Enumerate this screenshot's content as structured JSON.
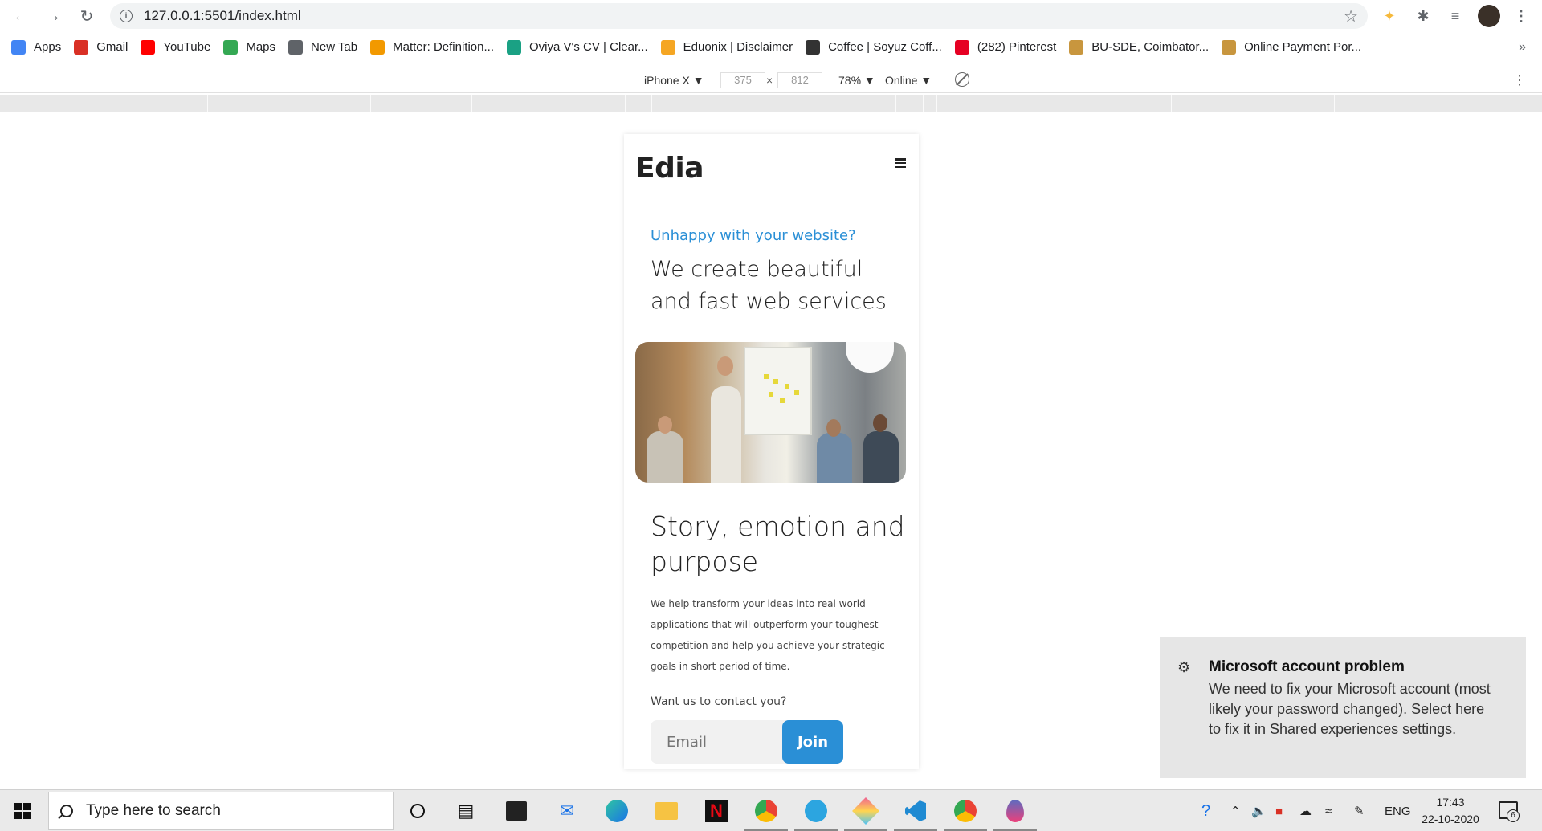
{
  "browser": {
    "url": "127.0.0.1:5501/index.html",
    "bookmarks": [
      {
        "label": "Apps",
        "icon": "apps-grid-icon",
        "color": "#4285f4"
      },
      {
        "label": "Gmail",
        "icon": "gmail-icon",
        "color": "#d93025"
      },
      {
        "label": "YouTube",
        "icon": "youtube-icon",
        "color": "#ff0000"
      },
      {
        "label": "Maps",
        "icon": "maps-pin-icon",
        "color": "#34a853"
      },
      {
        "label": "New Tab",
        "icon": "globe-icon",
        "color": "#5f6368"
      },
      {
        "label": "Matter: Definition...",
        "icon": "matter-icon",
        "color": "#f29900"
      },
      {
        "label": "Oviya V's CV | Clear...",
        "icon": "c-logo-icon",
        "color": "#1aa184"
      },
      {
        "label": "Eduonix | Disclaimer",
        "icon": "eduonix-icon",
        "color": "#f5a623"
      },
      {
        "label": "Coffee | Soyuz Coff...",
        "icon": "coffee-icon",
        "color": "#333333"
      },
      {
        "label": "(282) Pinterest",
        "icon": "pinterest-icon",
        "color": "#e60023"
      },
      {
        "label": "BU-SDE, Coimbator...",
        "icon": "person-icon",
        "color": "#c8963e"
      },
      {
        "label": "Online Payment Por...",
        "icon": "person-icon",
        "color": "#c8963e"
      }
    ],
    "bookmarks_more": "»"
  },
  "device_toolbar": {
    "device": "iPhone X ▼",
    "width": "375",
    "times": "×",
    "height": "812",
    "zoom": "78% ▼",
    "throttle": "Online ▼"
  },
  "page": {
    "logo": "Edia",
    "eyebrow": "Unhappy with your website?",
    "headline": "We create beautiful and fast web services",
    "section_title": "Story, emotion and purpose",
    "body": "We help transform your ideas into real world applications that will outperform your toughest competition and help you achieve your strategic goals in short period of time.",
    "contact_question": "Want us to contact you?",
    "email_placeholder": "Email",
    "join_label": "Join",
    "accent_color": "#2a8fd6"
  },
  "toast": {
    "title": "Microsoft account problem",
    "body": "We need to fix your Microsoft account (most likely your password changed). Select here to fix it in Shared experiences settings."
  },
  "taskbar": {
    "search_placeholder": "Type here to search",
    "language": "ENG",
    "time": "17:43",
    "date": "22-10-2020",
    "notification_count": "6"
  }
}
